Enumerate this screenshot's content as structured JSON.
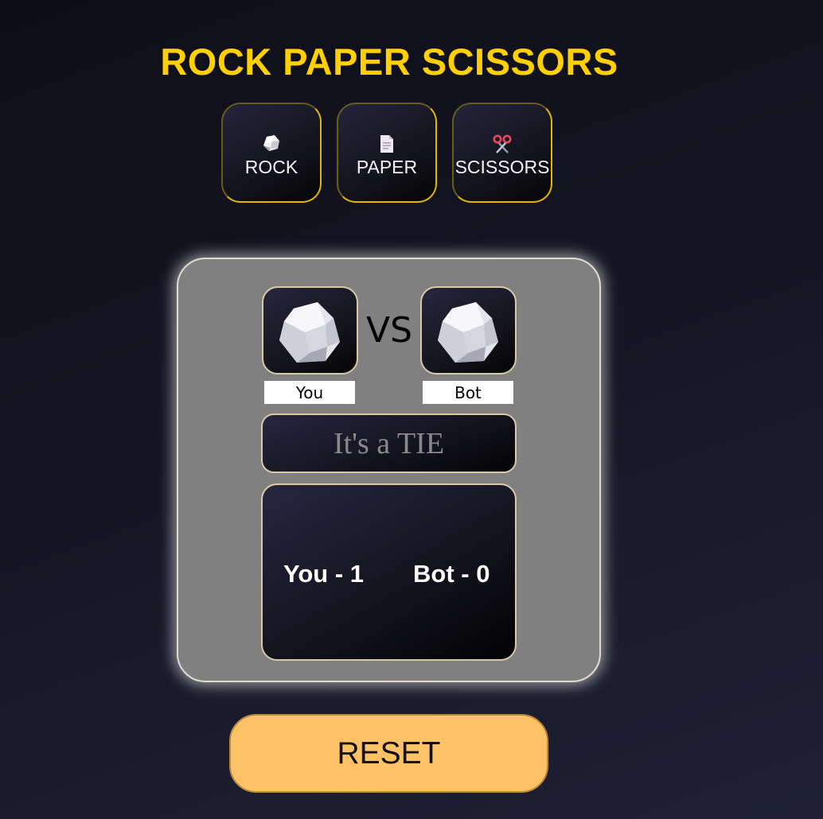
{
  "title": "ROCK PAPER SCISSORS",
  "choices": [
    {
      "label": "ROCK",
      "icon": "rock-icon"
    },
    {
      "label": "PAPER",
      "icon": "paper-icon"
    },
    {
      "label": "SCISSORS",
      "icon": "scissors-icon"
    }
  ],
  "match": {
    "you_choice_icon": "rock-icon",
    "bot_choice_icon": "rock-icon",
    "vs_label": "VS",
    "you_label": "You",
    "bot_label": "Bot",
    "result": "It's a TIE"
  },
  "score": {
    "you": "You - 1",
    "bot": "Bot - 0"
  },
  "reset_label": "RESET",
  "colors": {
    "title": "#ffd000",
    "board": "#808080",
    "reset": "#ffc266",
    "button_border": "#e3b400"
  }
}
